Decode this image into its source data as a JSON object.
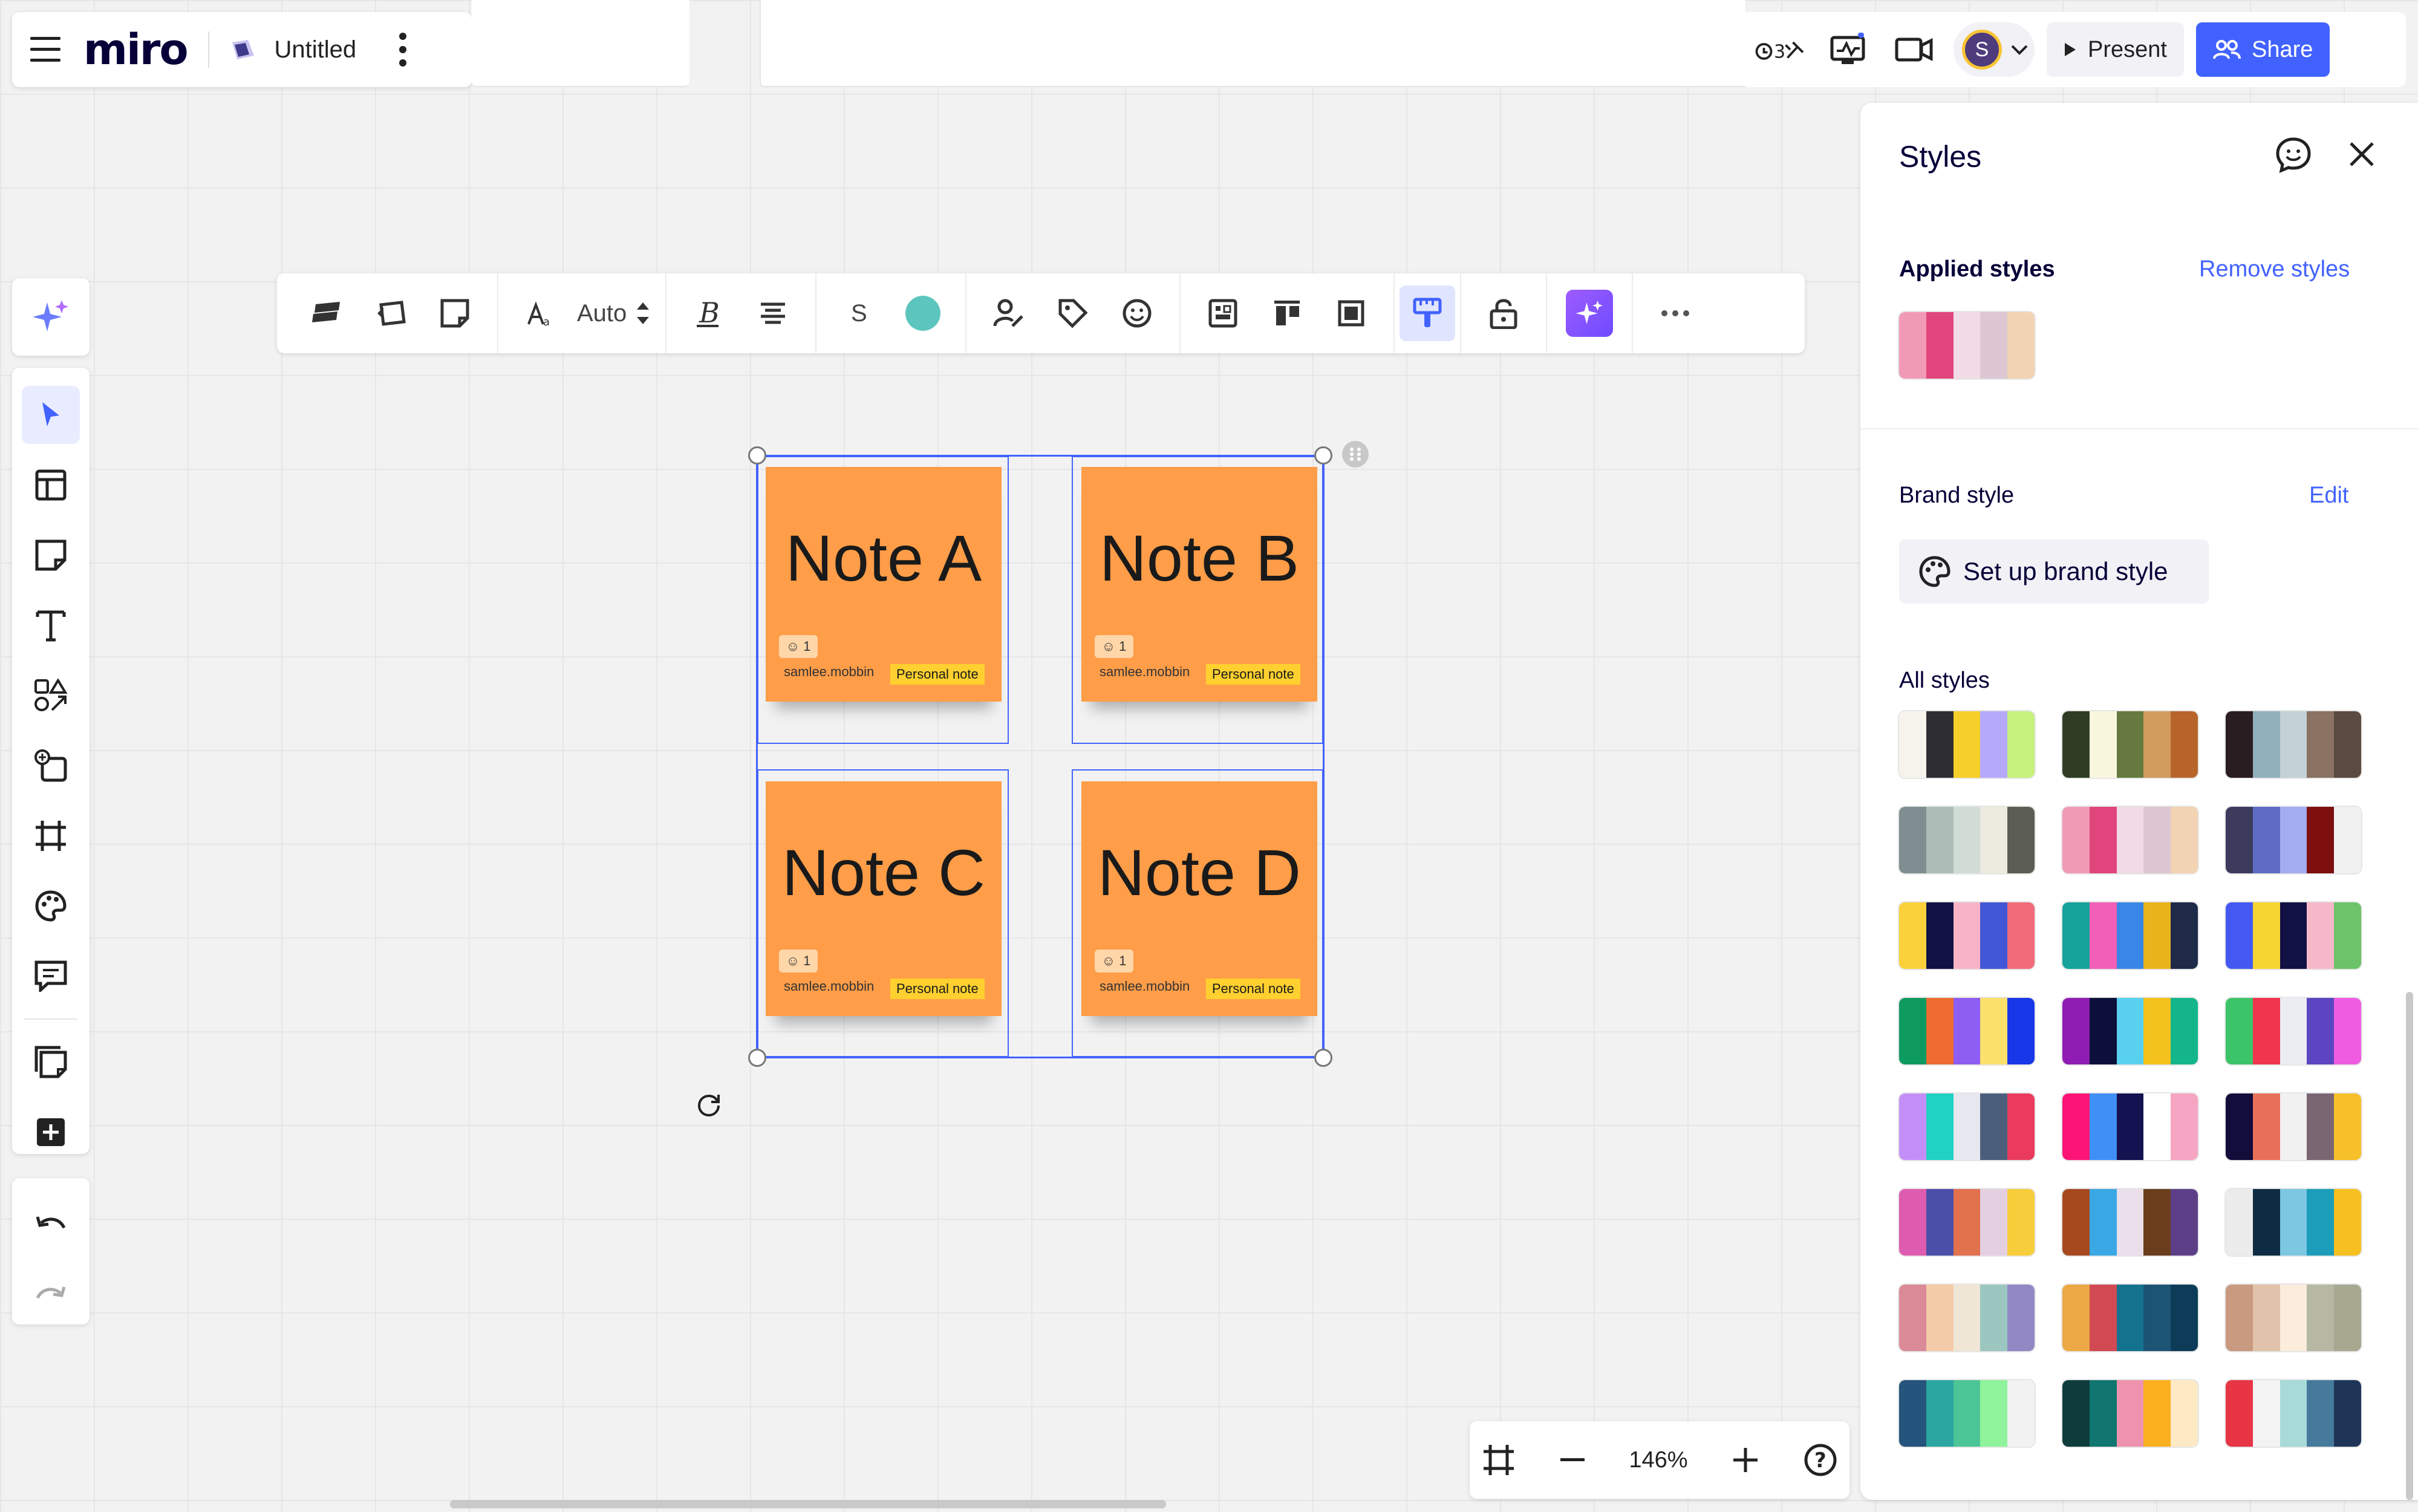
{
  "app": {
    "logo": "miro",
    "board_name": "Untitled"
  },
  "header": {
    "present_label": "Present",
    "share_label": "Share",
    "avatar_initial": "S"
  },
  "toolbar": {
    "font_size": "Auto",
    "shape_letter": "S",
    "fill_color": "#5cc6be"
  },
  "notes": [
    {
      "title": "Note A",
      "author": "samlee.mobbin",
      "tag": "Personal note",
      "reaction_count": "1"
    },
    {
      "title": "Note B",
      "author": "samlee.mobbin",
      "tag": "Personal note",
      "reaction_count": "1"
    },
    {
      "title": "Note C",
      "author": "samlee.mobbin",
      "tag": "Personal note",
      "reaction_count": "1"
    },
    {
      "title": "Note D",
      "author": "samlee.mobbin",
      "tag": "Personal note",
      "reaction_count": "1"
    }
  ],
  "styles_panel": {
    "title": "Styles",
    "applied_heading": "Applied styles",
    "remove_label": "Remove styles",
    "applied_palette": [
      "#f19ab5",
      "#e0457b",
      "#f1dbe6",
      "#dcc7d3",
      "#f2d3b3"
    ],
    "brand_label": "Brand style",
    "edit_label": "Edit",
    "setup_label": "Set up brand style",
    "all_label": "All styles",
    "palettes": [
      [
        "#f6f3ec",
        "#2d2d33",
        "#f7cf2a",
        "#b4a9fb",
        "#c8f27e"
      ],
      [
        "#2f3d25",
        "#f8f6dd",
        "#667a3f",
        "#d19c5d",
        "#b7652b"
      ],
      [
        "#2a1d21",
        "#91b0ba",
        "#c3d2d6",
        "#8b7262",
        "#5a4a3f"
      ],
      [
        "#7f8e90",
        "#adbcb6",
        "#d1dcd6",
        "#ecebdf",
        "#5c5d53"
      ],
      [
        "#f19ab5",
        "#e0457b",
        "#f1dbe6",
        "#dcc7d3",
        "#f2d3b3"
      ],
      [
        "#3c3b5e",
        "#5f6cc4",
        "#a3acf0",
        "#7d0f0f",
        "#f1f1f1"
      ],
      [
        "#fbd13b",
        "#111144",
        "#f8b3c7",
        "#4257d6",
        "#f26b7a"
      ],
      [
        "#15a39a",
        "#f25fb8",
        "#3a86e6",
        "#e9b31c",
        "#1f2a49"
      ],
      [
        "#4459f2",
        "#f6d532",
        "#111144",
        "#f6b8c8",
        "#6cc36a"
      ],
      [
        "#0f9a60",
        "#ee6b31",
        "#8e5df2",
        "#fbe06c",
        "#1737e8"
      ],
      [
        "#8f1cb3",
        "#0b0f39",
        "#5ad0f0",
        "#f4c21c",
        "#14b58a"
      ],
      [
        "#3cc468",
        "#f0364e",
        "#ececf3",
        "#5b45c1",
        "#ef5ce2"
      ],
      [
        "#c38ff7",
        "#1fd2c1",
        "#e7e7ef",
        "#4b5f7c",
        "#ea3b5f"
      ],
      [
        "#fc1576",
        "#3f8ff7",
        "#141250",
        "#ffffff",
        "#f6a6c2"
      ],
      [
        "#120d3a",
        "#e87058",
        "#f1f1f1",
        "#7a6573",
        "#f7c02a"
      ],
      [
        "#de5caf",
        "#4b4fa8",
        "#e2714d",
        "#e4cfe2",
        "#f7cd3b"
      ],
      [
        "#a6491f",
        "#39a8e4",
        "#eadfea",
        "#6a3e1c",
        "#5d3f87"
      ],
      [
        "#ececec",
        "#0d2c44",
        "#7ec7e2",
        "#1c9eba",
        "#f6c020"
      ],
      [
        "#db8a98",
        "#f4cba8",
        "#efe6d5",
        "#9cc7c0",
        "#9188c4"
      ],
      [
        "#eba844",
        "#d14a53",
        "#13738f",
        "#1c5474",
        "#0c3c57"
      ],
      [
        "#c99a80",
        "#e1c2aa",
        "#fbecdc",
        "#b6b8a3",
        "#a6a890"
      ],
      [
        "#25547c",
        "#2ba6a0",
        "#4bc496",
        "#8ff39c",
        "#f2f2f2"
      ],
      [
        "#0e3c3c",
        "#10766f",
        "#ee93ad",
        "#fbb020",
        "#fde9c4"
      ],
      [
        "#e73545",
        "#f3f3f3",
        "#a7dad8",
        "#457a9c",
        "#1e3558"
      ]
    ]
  },
  "zoom": {
    "level": "146%"
  }
}
